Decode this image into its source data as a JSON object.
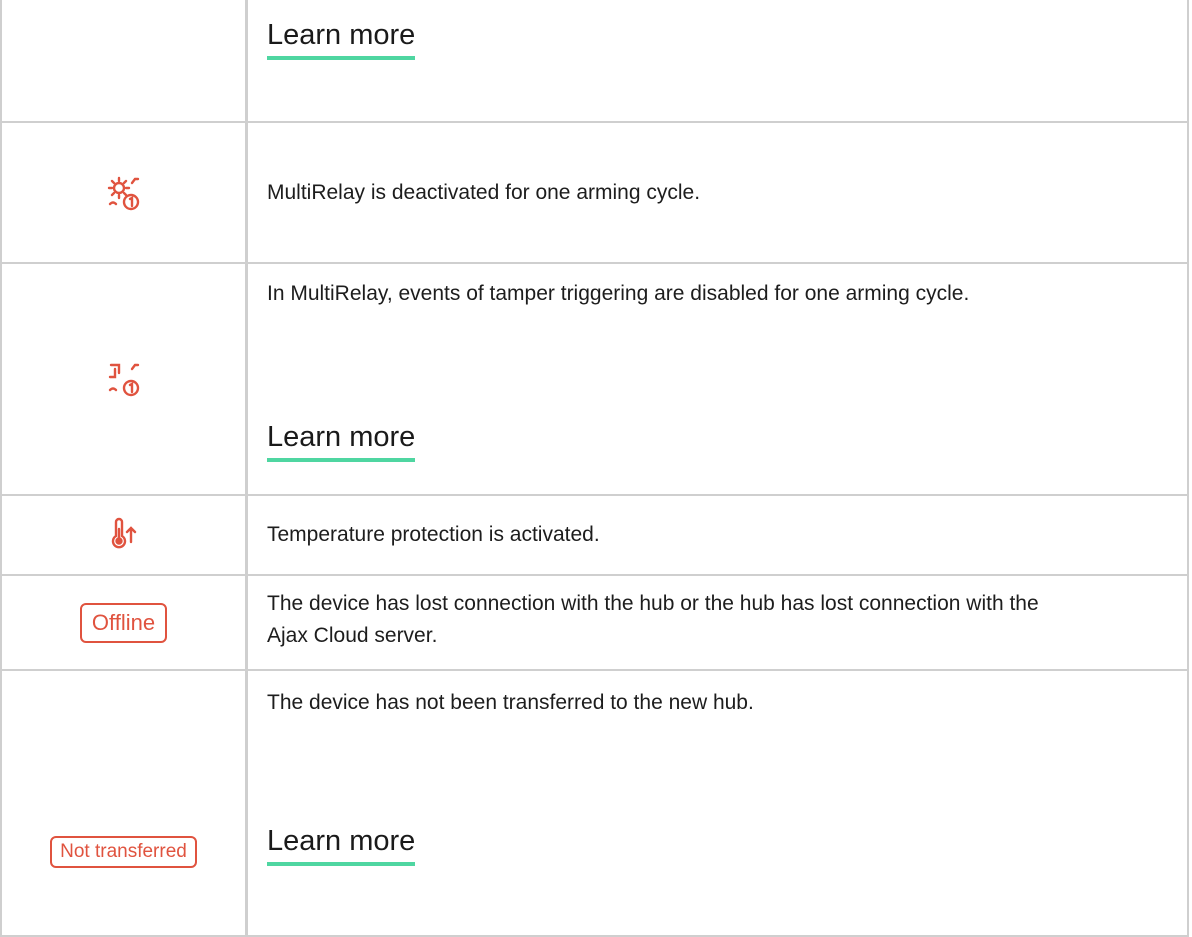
{
  "rows": [
    {
      "icon": "none",
      "description": "",
      "link": "Learn more"
    },
    {
      "icon": "gear-deactivated-one-cycle-icon",
      "description": "MultiRelay is deactivated for one arming cycle."
    },
    {
      "icon": "tamper-disabled-one-cycle-icon",
      "description": "In MultiRelay, events of tamper triggering are disabled for one arming cycle.",
      "link": "Learn more"
    },
    {
      "icon": "thermometer-up-icon",
      "description": "Temperature protection is activated."
    },
    {
      "badge": "Offline",
      "description": "The device has lost connection with the hub or the hub has lost connection with the Ajax Cloud server."
    },
    {
      "badge": "Not transferred",
      "description": "The device has not been transferred to the new hub.",
      "link": "Learn more"
    }
  ],
  "colors": {
    "icon": "#e0533f",
    "link_underline": "#4fd6a1",
    "border": "#cfcfcf"
  }
}
